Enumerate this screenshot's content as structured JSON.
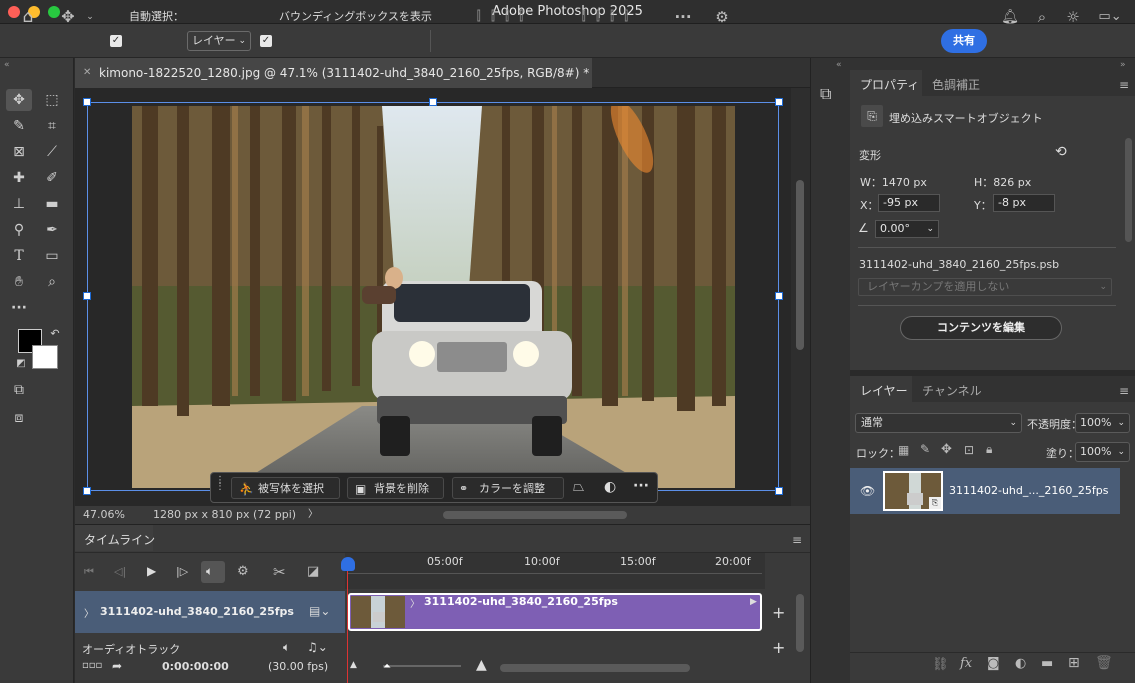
{
  "app": {
    "title": "Adobe Photoshop 2025"
  },
  "colors": {
    "accent": "#2f6fe3",
    "clip": "#7e5fb4",
    "panel": "#3a3a3a",
    "playhead": "#d33"
  },
  "options": {
    "auto_select_label": "自動選択：",
    "auto_select_value": "レイヤー",
    "bbox_label": "バウンディングボックスを表示",
    "share_label": "共有"
  },
  "toolbar": {
    "icons": [
      "move-icon",
      "marquee-icon",
      "quick-select-icon",
      "crop-icon",
      "frame-icon",
      "eyedropper-icon",
      "healing-icon",
      "brush-icon",
      "stamp-icon",
      "gradient-icon",
      "dodge-icon",
      "pen-icon",
      "type-icon",
      "rectangle-icon",
      "hand-icon",
      "zoom-icon",
      "more-icon",
      "swap-icon",
      "default-colors-icon",
      "quickmask-icon",
      "screenmode-icon"
    ]
  },
  "document": {
    "tab_title": "kimono-1822520_1280.jpg @ 47.1% (3111402-uhd_3840_2160_25fps, RGB/8#) *",
    "zoom": "47.06%",
    "dimensions": "1280 px x 810 px (72 ppi)"
  },
  "contextbar": {
    "select_subject": "被写体を選択",
    "remove_bg": "背景を削除",
    "adjust_color": "カラーを調整"
  },
  "timeline": {
    "title": "タイムライン",
    "ruler": [
      "05:00f",
      "10:00f",
      "15:00f",
      "20:00f"
    ],
    "track_name": "3111402-uhd_3840_2160_25fps",
    "clip_label": "3111402-uhd_3840_2160_25fps",
    "audio_track": "オーディオトラック",
    "timecode": "0:00:00:00",
    "fps": "(30.00 fps)"
  },
  "properties": {
    "tab_props": "プロパティ",
    "tab_adjust": "色調補正",
    "object_type": "埋め込みスマートオブジェクト",
    "transform_label": "変形",
    "w": "W：1470 px",
    "h": "H：826 px",
    "x_label": "X：",
    "x_value": "-95 px",
    "y_label": "Y：",
    "y_value": "-8 px",
    "angle_value": "0.00°",
    "filename": "3111402-uhd_3840_2160_25fps.psb",
    "layer_comp": "レイヤーカンプを適用しない",
    "edit_contents": "コンテンツを編集"
  },
  "layers": {
    "tab_layers": "レイヤー",
    "tab_channels": "チャンネル",
    "blend_mode": "通常",
    "opacity_label": "不透明度：",
    "opacity": "100%",
    "lock_label": "ロック：",
    "fill_label": "塗り：",
    "fill": "100%",
    "layer_name": "3111402-uhd_..._2160_25fps"
  }
}
